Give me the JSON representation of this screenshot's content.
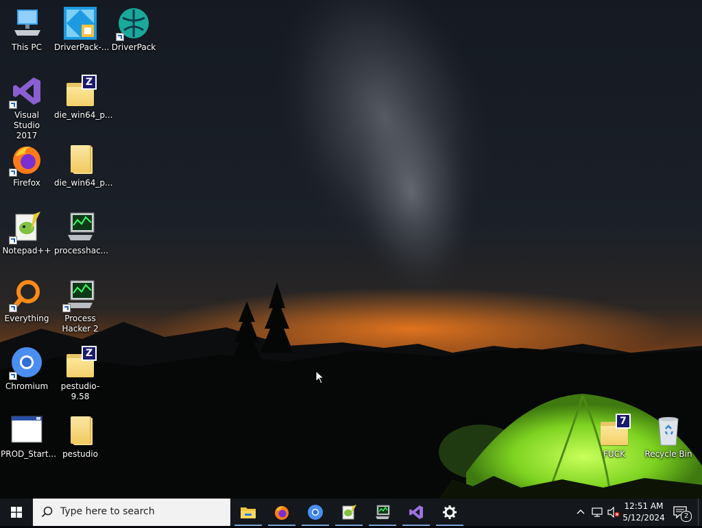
{
  "desktop": {
    "icons": [
      {
        "id": "this-pc",
        "label": "This PC"
      },
      {
        "id": "driverpack-dots",
        "label": "DriverPack-..."
      },
      {
        "id": "driverpack",
        "label": "DriverPack"
      },
      {
        "id": "visual-studio",
        "label": "Visual Studio\n2017"
      },
      {
        "id": "die-win64-zip",
        "label": "die_win64_p..."
      },
      {
        "id": "firefox",
        "label": "Firefox"
      },
      {
        "id": "die-win64-folder",
        "label": "die_win64_p..."
      },
      {
        "id": "notepadpp",
        "label": "Notepad++"
      },
      {
        "id": "processhacker-dots",
        "label": "processhac..."
      },
      {
        "id": "everything",
        "label": "Everything"
      },
      {
        "id": "process-hacker-2",
        "label": "Process\nHacker 2"
      },
      {
        "id": "chromium",
        "label": "Chromium"
      },
      {
        "id": "pestudio-958",
        "label": "pestudio-9.58"
      },
      {
        "id": "prod-start",
        "label": "PROD_Start..."
      },
      {
        "id": "pestudio",
        "label": "pestudio"
      },
      {
        "id": "fuck",
        "label": "FUCK"
      },
      {
        "id": "recycle-bin",
        "label": "Recycle Bin"
      }
    ]
  },
  "taskbar": {
    "search_placeholder": "Type here to search",
    "pinned_apps": [
      "File Explorer",
      "Firefox",
      "Chromium",
      "Notepad++",
      "Process Hacker",
      "Visual Studio",
      "Settings"
    ],
    "clock": {
      "time": "12:51 AM",
      "date": "5/12/2024"
    },
    "notification_count": "2"
  },
  "colors": {
    "taskbar_bg": "#14171c",
    "tent_green": "#7ed321",
    "horizon_orange": "#d8661c"
  }
}
